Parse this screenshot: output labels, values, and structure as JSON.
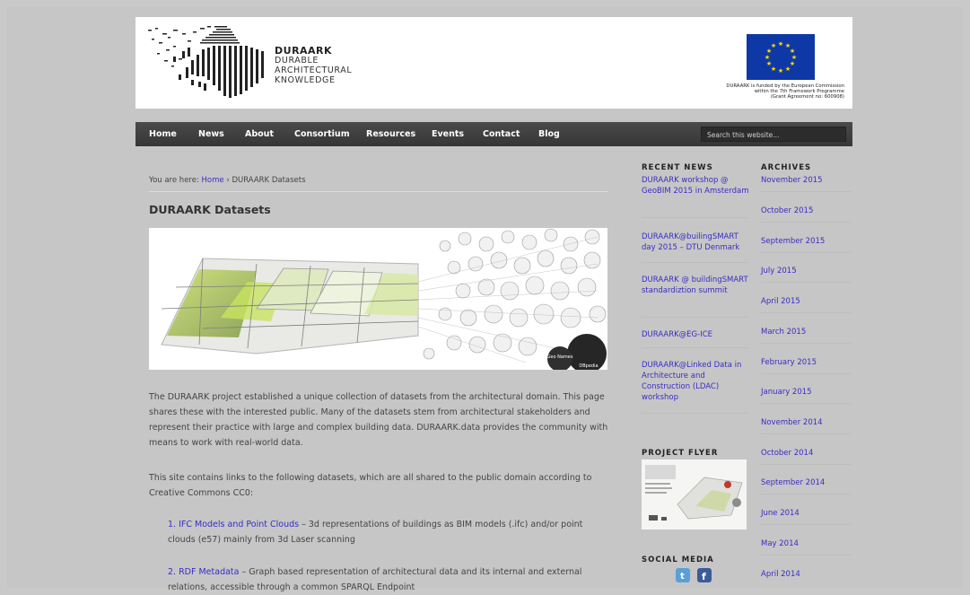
{
  "header": {
    "logo_line1": "DURAARK",
    "logo_line2": "DURABLE",
    "logo_line3": "ARCHITECTURAL",
    "logo_line4": "KNOWLEDGE",
    "eu_text_1": "DURAARK is funded by the European Commission",
    "eu_text_2": "within the 7th Framework Programme",
    "eu_text_3": "(Grant Agreement no: 600908)"
  },
  "nav": {
    "items": [
      "Home",
      "News",
      "About",
      "Consortium",
      "Resources",
      "Events",
      "Contact",
      "Blog"
    ],
    "search_placeholder": "Search this website..."
  },
  "breadcrumb": {
    "prefix": "You are here: ",
    "home": "Home",
    "sep": " › ",
    "current": "DURAARK Datasets"
  },
  "main": {
    "title": "DURAARK Datasets",
    "banner_labels": [
      "Geo Names",
      "DBpedia"
    ],
    "intro": "The DURAARK project established a unique collection of datasets from the architectural domain. This page shares these  with the interested public. Many of the datasets stem from architectural stakeholders and represent their practice with large and complex building data. DURAARK.data provides the community with means to work with real-world data.",
    "intro2": "This site contains links to the following datasets, which are all shared to the public domain according to Creative Commons CC0:",
    "list": [
      {
        "link": "1. IFC Models and Point Clouds",
        "text": " – 3d representations of buildings as BIM models (.ifc) and/or point clouds (e57) mainly from 3d Laser scanning"
      },
      {
        "link": "2. RDF Metadata",
        "text": " – Graph based representation of architectural data and its internal and external relations, accessible through a common SPARQL Endpoint"
      }
    ]
  },
  "sidebar": {
    "recent_news_title": "RECENT NEWS",
    "news": [
      "DURAARK workshop @ GeoBIM 2015 in Amsterdam",
      "DURAARK@builingSMART day 2015 – DTU Denmark",
      "DURAARK @ buildingSMART standardiztion summit",
      "DURAARK@EG-ICE",
      "DURAARK@Linked Data in Architecture and Construction (LDAC) workshop"
    ],
    "flyer_title": "PROJECT FLYER",
    "social_title": "SOCIAL MEDIA",
    "archives_title": "ARCHIVES",
    "archives": [
      "November 2015",
      "October 2015",
      "September 2015",
      "July 2015",
      "April 2015",
      "March 2015",
      "February 2015",
      "January 2015",
      "November 2014",
      "October 2014",
      "September 2014",
      "June 2014",
      "May 2014",
      "April 2014"
    ]
  },
  "colors": {
    "link": "#3a2cc4",
    "nav_bg": "#3e3e3e",
    "page_bg": "#c9c9c9",
    "eu_blue": "#0e38a5",
    "eu_star": "#ffdd00"
  }
}
